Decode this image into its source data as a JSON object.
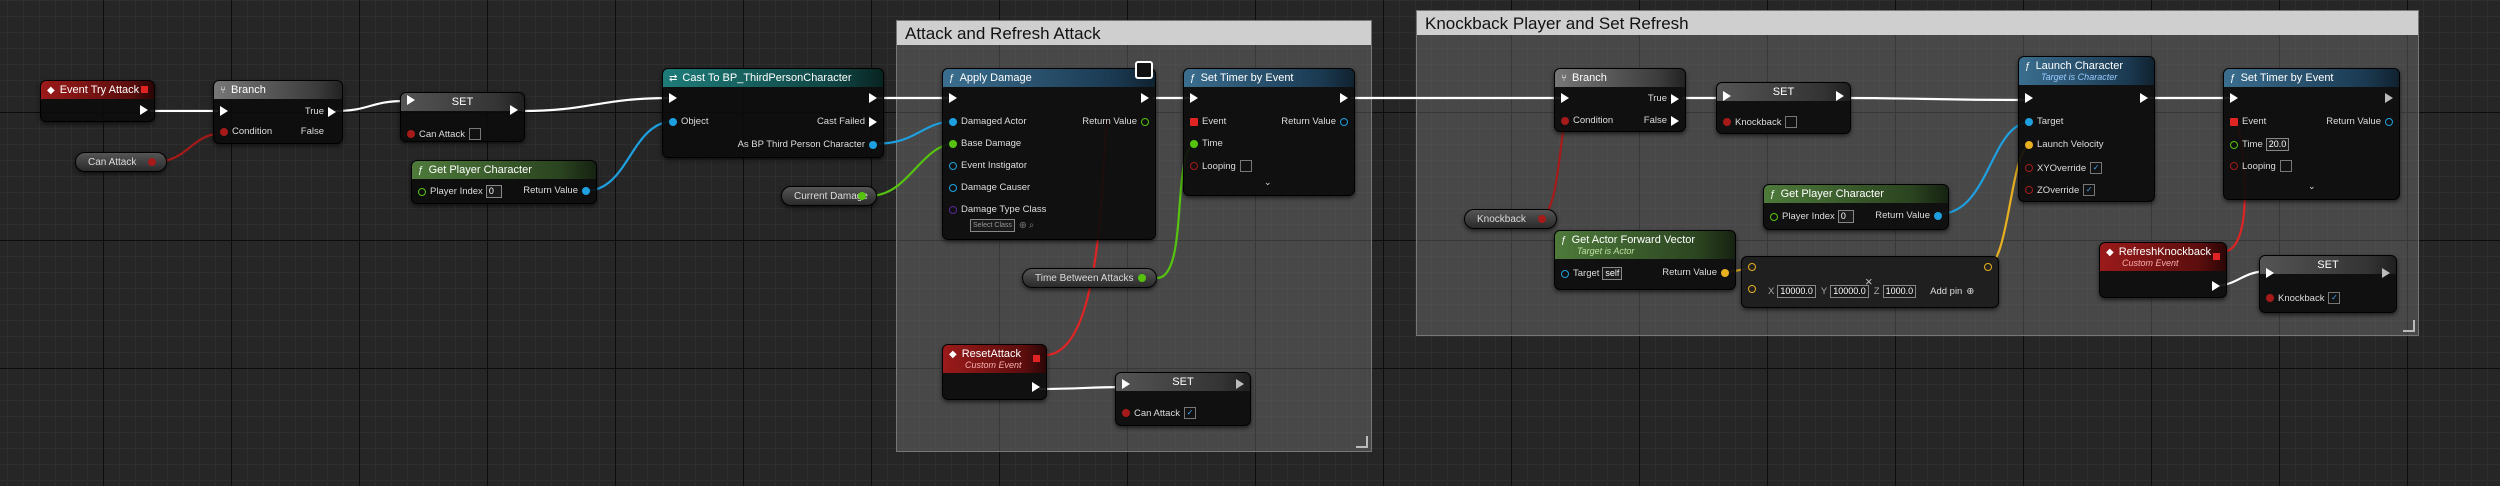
{
  "comments": {
    "attack": "Attack and Refresh Attack",
    "knockback": "Knockback Player and Set Refresh"
  },
  "nodes": {
    "event_try_attack": {
      "title": "Event Try Attack"
    },
    "branch1": {
      "title": "Branch",
      "condition": "Condition",
      "true": "True",
      "false": "False"
    },
    "set_can_attack": {
      "title": "SET",
      "pin": "Can Attack"
    },
    "can_attack_var": {
      "title": "Can Attack"
    },
    "get_player_char1": {
      "title": "Get Player Character",
      "player_index": "Player Index",
      "index_value": "0",
      "return": "Return Value"
    },
    "cast": {
      "title": "Cast To BP_ThirdPersonCharacter",
      "object": "Object",
      "cast_failed": "Cast Failed",
      "as_bp": "As BP Third Person Character"
    },
    "apply_damage": {
      "title": "Apply Damage",
      "damaged_actor": "Damaged Actor",
      "base_damage": "Base Damage",
      "event_instigator": "Event Instigator",
      "damage_causer": "Damage Causer",
      "damage_type_class": "Damage Type Class",
      "select_class": "Select Class",
      "return": "Return Value"
    },
    "current_damage": {
      "title": "Current Damage"
    },
    "set_timer1": {
      "title": "Set Timer by Event",
      "event": "Event",
      "time": "Time",
      "looping": "Looping",
      "return": "Return Value"
    },
    "time_between": {
      "title": "Time Between Attacks"
    },
    "reset_attack": {
      "title": "ResetAttack",
      "subtitle": "Custom Event"
    },
    "set_can_attack2": {
      "title": "SET",
      "pin": "Can Attack"
    },
    "branch2": {
      "title": "Branch",
      "condition": "Condition",
      "true": "True",
      "false": "False"
    },
    "set_knockback": {
      "title": "SET",
      "pin": "Knockback"
    },
    "knockback_var": {
      "title": "Knockback"
    },
    "get_forward": {
      "title": "Get Actor Forward Vector",
      "subtitle": "Target is Actor",
      "target": "Target",
      "target_value": "self",
      "return": "Return Value"
    },
    "get_player_char2": {
      "title": "Get Player Character",
      "player_index": "Player Index",
      "index_value": "0",
      "return": "Return Value"
    },
    "multiply": {
      "x_label": "X",
      "x": "10000.0",
      "y_label": "Y",
      "y": "10000.0",
      "z_label": "Z",
      "z": "1000.0",
      "add_pin": "Add pin"
    },
    "launch": {
      "title": "Launch Character",
      "subtitle": "Target is Character",
      "target": "Target",
      "velocity": "Launch Velocity",
      "xy": "XYOverride",
      "z": "ZOverride"
    },
    "set_timer2": {
      "title": "Set Timer by Event",
      "event": "Event",
      "time": "Time",
      "time_value": "20.0",
      "looping": "Looping",
      "return": "Return Value"
    },
    "refresh_knockback": {
      "title": "RefreshKnockback",
      "subtitle": "Custom Event"
    },
    "set_knockback2": {
      "title": "SET",
      "pin": "Knockback"
    }
  },
  "colors": {
    "exec": "#ffffff",
    "bool": "#a61a1a",
    "object": "#1ea0e0",
    "float": "#56c40f",
    "vector": "#e8b020",
    "class": "#5a2aa0"
  }
}
